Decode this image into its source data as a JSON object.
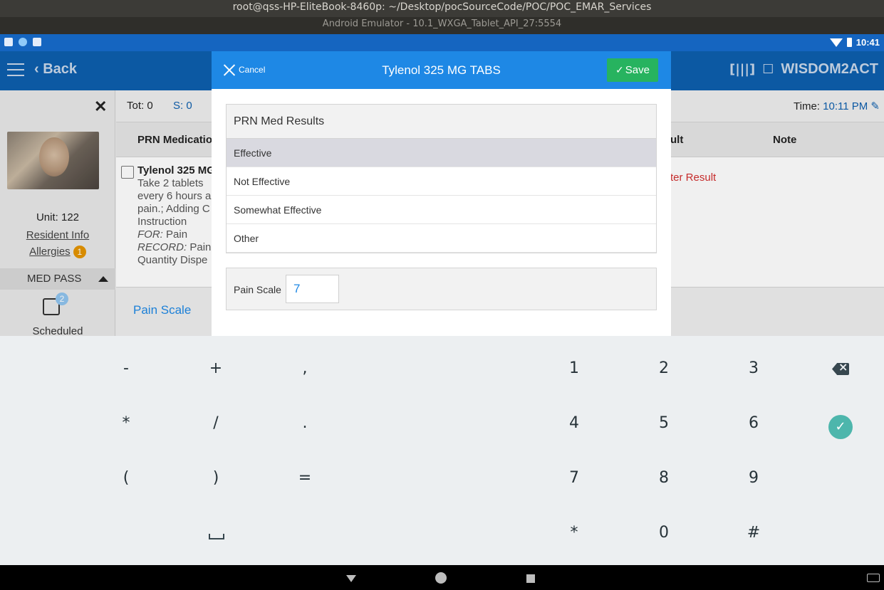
{
  "host": {
    "terminal_title": "root@qss-HP-EliteBook-8460p: ~/Desktop/pocSourceCode/POC/POC_EMAR_Services",
    "emulator_title": "Android Emulator - 10.1_WXGA_Tablet_API_27:5554"
  },
  "status_bar": {
    "time": "10:41"
  },
  "app": {
    "back_label": "Back",
    "brand": "WISDOM2ACT",
    "resident": {
      "unit": "Unit: 122",
      "info_link": "Resident Info",
      "allergies_link": "Allergies",
      "allergies_count": "1",
      "med_pass": "MED PASS",
      "scheduled_label": "Scheduled",
      "scheduled_count": "2"
    },
    "summary": {
      "tot": "Tot: 0",
      "s": "S: 0",
      "time_label": "Time:",
      "time_value": "10:11 PM"
    },
    "table_headers": {
      "medication": "PRN Medicatio",
      "result": "ult",
      "note": "Note"
    },
    "med_row": {
      "name": "Tylenol 325 MG",
      "lines": [
        "Take 2 tablets",
        "every 6 hours a",
        "pain.; Adding C",
        "Instruction"
      ],
      "for_label": "FOR:",
      "for_value": "Pain",
      "record_label": "RECORD:",
      "record_value": "Pain",
      "quantity": "Quantity Dispe",
      "result_link": "ter Result"
    },
    "pain_scale_row": "Pain Scale"
  },
  "modal": {
    "cancel_label": "Cancel",
    "title": "Tylenol 325 MG TABS",
    "save_label": "Save",
    "results_header": "PRN Med Results",
    "options": [
      "Effective",
      "Not Effective",
      "Somewhat Effective",
      "Other"
    ],
    "selected_option": "Effective",
    "pain_scale_label": "Pain Scale",
    "pain_scale_value": "7"
  },
  "keyboard": {
    "keys": [
      [
        "-",
        "+",
        ",",
        "1",
        "2",
        "3"
      ],
      [
        "*",
        "/",
        ".",
        "4",
        "5",
        "6"
      ],
      [
        "(",
        ")",
        "=",
        "7",
        "8",
        "9"
      ],
      [
        "",
        "",
        "",
        "*",
        "0",
        "#"
      ]
    ],
    "backspace_icon": "backspace-icon",
    "enter_icon": "checkmark-icon",
    "space_icon": "space-icon"
  },
  "colors": {
    "app_header": "#0d5fae",
    "modal_header": "#1e88e5",
    "save_button": "#27b35f",
    "selected_option": "#d9d9e0",
    "enter_key": "#4db6ac",
    "result_link": "#d32f2f"
  }
}
